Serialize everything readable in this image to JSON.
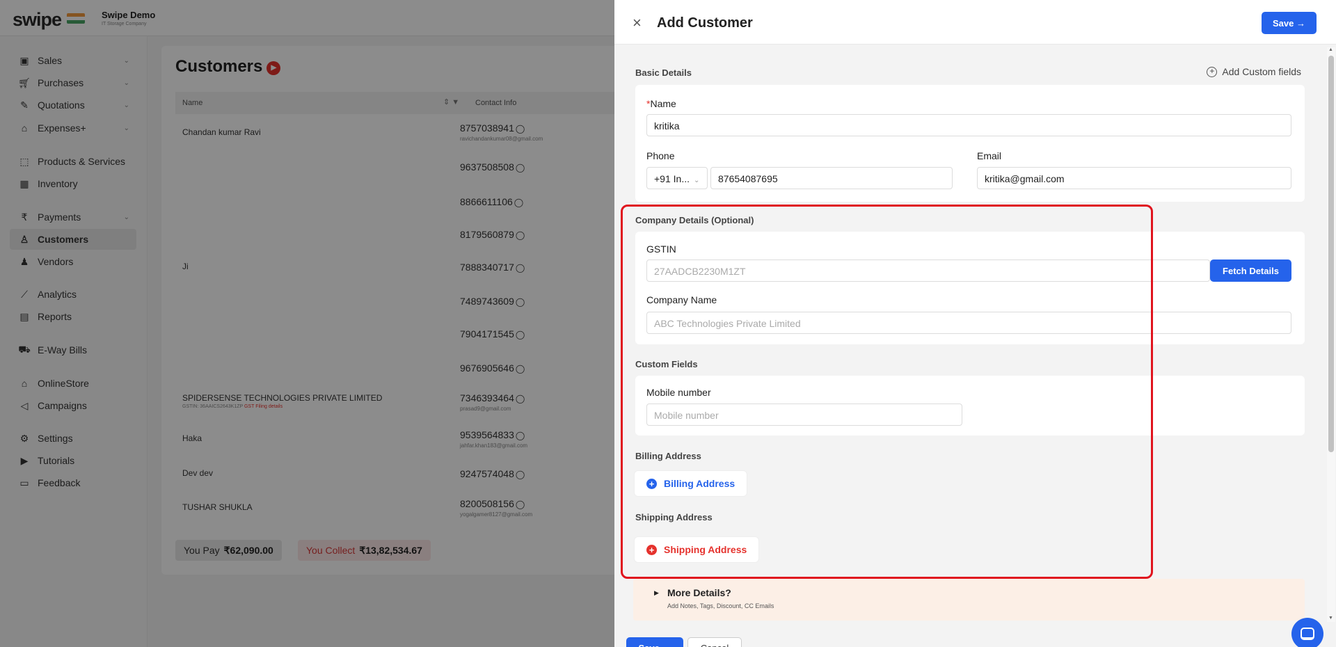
{
  "app": {
    "logo": "swipe",
    "company_name": "Swipe Demo",
    "company_sub": "IT Storage Company"
  },
  "sidebar": {
    "items": [
      {
        "label": "Sales",
        "icon": "receipt-icon",
        "has_chevron": true
      },
      {
        "label": "Purchases",
        "icon": "cart-icon",
        "has_chevron": true
      },
      {
        "label": "Quotations",
        "icon": "pen-icon",
        "has_chevron": true
      },
      {
        "label": "Expenses+",
        "icon": "tag-icon",
        "has_chevron": true
      },
      {
        "label": "Products & Services",
        "icon": "box-scan-icon",
        "has_chevron": false
      },
      {
        "label": "Inventory",
        "icon": "warehouse-icon",
        "has_chevron": false
      },
      {
        "label": "Payments",
        "icon": "rupee-icon",
        "has_chevron": true
      },
      {
        "label": "Customers",
        "icon": "user-icon",
        "has_chevron": false,
        "active": true
      },
      {
        "label": "Vendors",
        "icon": "users-icon",
        "has_chevron": false
      },
      {
        "label": "Analytics",
        "icon": "line-chart-icon",
        "has_chevron": false
      },
      {
        "label": "Reports",
        "icon": "report-icon",
        "has_chevron": false
      },
      {
        "label": "E-Way Bills",
        "icon": "truck-icon",
        "has_chevron": false
      },
      {
        "label": "OnlineStore",
        "icon": "store-icon",
        "has_chevron": false
      },
      {
        "label": "Campaigns",
        "icon": "megaphone-icon",
        "has_chevron": false
      },
      {
        "label": "Settings",
        "icon": "gear-icon",
        "has_chevron": false
      },
      {
        "label": "Tutorials",
        "icon": "youtube-icon",
        "has_chevron": false
      },
      {
        "label": "Feedback",
        "icon": "chat-icon",
        "has_chevron": false
      }
    ]
  },
  "customers": {
    "title": "Customers",
    "columns": {
      "name": "Name",
      "contact": "Contact Info"
    },
    "rows": [
      {
        "name": "Chandan kumar Ravi",
        "sub": "",
        "sub_red": "",
        "phone": "8757038941",
        "email": "ravichandankumar08@gmail.com"
      },
      {
        "name": "",
        "sub": "",
        "sub_red": "",
        "phone": "9637508508",
        "email": ""
      },
      {
        "name": "",
        "sub": "",
        "sub_red": "",
        "phone": "8866611106",
        "email": ""
      },
      {
        "name": "",
        "sub": "",
        "sub_red": "",
        "phone": "8179560879",
        "email": ""
      },
      {
        "name": "Ji",
        "sub": "",
        "sub_red": "",
        "phone": "7888340717",
        "email": ""
      },
      {
        "name": "",
        "sub": "",
        "sub_red": "",
        "phone": "7489743609",
        "email": ""
      },
      {
        "name": "",
        "sub": "",
        "sub_red": "",
        "phone": "7904171545",
        "email": ""
      },
      {
        "name": "",
        "sub": "",
        "sub_red": "",
        "phone": "9676905646",
        "email": ""
      },
      {
        "name": "SPIDERSENSE TECHNOLOGIES PRIVATE LIMITED",
        "sub": "GSTIN: 36AAICS2643K1ZP",
        "sub_red": "GST Filing details",
        "phone": "7346393464",
        "email": "prasad9@gmail.com"
      },
      {
        "name": "Haka",
        "sub": "",
        "sub_red": "",
        "phone": "9539564833",
        "email": "jahfar.khan183@gmail.com"
      },
      {
        "name": "Dev dev",
        "sub": "",
        "sub_red": "",
        "phone": "9247574048",
        "email": ""
      },
      {
        "name": "TUSHAR SHUKLA",
        "sub": "",
        "sub_red": "",
        "phone": "8200508156",
        "email": "yogalgamer8127@gmail.com"
      }
    ],
    "you_pay_label": "You Pay",
    "you_pay_value": "₹62,090.00",
    "you_collect_label": "You Collect",
    "you_collect_value": "₹13,82,534.67"
  },
  "drawer": {
    "title": "Add Customer",
    "save_label": "Save →",
    "basic_details": "Basic Details",
    "add_custom_fields": "Add Custom fields",
    "name_label": "Name",
    "name_value": "kritika",
    "phone_label": "Phone",
    "phone_code": "+91  In...",
    "phone_value": "87654087695",
    "email_label": "Email",
    "email_value": "kritika@gmail.com",
    "company_details": "Company Details (Optional)",
    "gstin_label": "GSTIN",
    "gstin_placeholder": "27AADCB2230M1ZT",
    "fetch_details": "Fetch Details",
    "company_name_label": "Company Name",
    "company_name_placeholder": "ABC Technologies Private Limited",
    "custom_fields": "Custom Fields",
    "mobile_label": "Mobile number",
    "mobile_placeholder": "Mobile number",
    "billing_section": "Billing Address",
    "billing_button": "Billing Address",
    "shipping_section": "Shipping Address",
    "shipping_button": "Shipping Address",
    "more_title": "More Details?",
    "more_sub": "Add Notes, Tags, Discount, CC Emails",
    "footer_save": "Save →",
    "footer_cancel": "Cancel"
  },
  "colors": {
    "primary": "#2563eb",
    "danger": "#e5322d",
    "highlight": "#e0141e"
  }
}
